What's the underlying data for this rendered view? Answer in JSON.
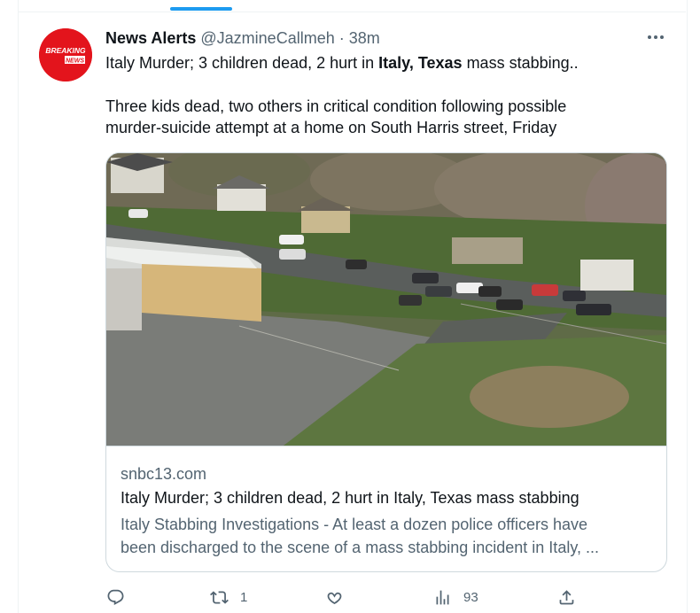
{
  "tweet": {
    "author_name": "News Alerts",
    "handle": "@JazmineCallmeh",
    "separator": "·",
    "time": "38m",
    "avatar_text_line1": "BREAKING",
    "avatar_text_line2": "NEWS",
    "line1_prefix": "Italy Murder; 3 children dead, 2 hurt in ",
    "line1_bold": "Italy, Texas",
    "line1_suffix": " mass stabbing..",
    "para_line1": "Three kids dead, two others in critical condition following possible",
    "para_line2": "murder-suicide attempt at a home on South Harris street, Friday"
  },
  "card": {
    "domain": "snbc13.com",
    "title": "Italy Murder; 3 children dead, 2 hurt in Italy, Texas mass stabbing",
    "desc_line1": "Italy Stabbing Investigations - At least a dozen police officers have",
    "desc_line2": "been discharged to the scene of a mass stabbing incident in Italy, ..."
  },
  "actions": {
    "reply_count": "",
    "retweet_count": "1",
    "like_count": "",
    "views_count": "93"
  },
  "icons": [
    "more-icon",
    "reply-icon",
    "retweet-icon",
    "like-icon",
    "views-icon",
    "share-icon"
  ],
  "colors": {
    "accent": "#1d9bf0",
    "avatar_red": "#e3141c",
    "muted": "#536471",
    "text": "#0f1419",
    "border": "#cfd9de"
  }
}
